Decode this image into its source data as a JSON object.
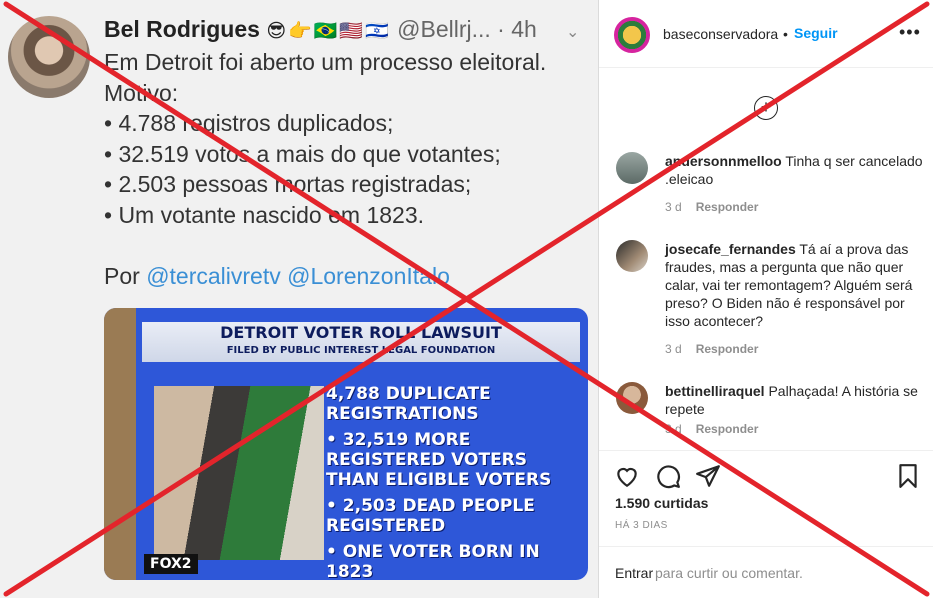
{
  "tweet": {
    "author_name": "Bel Rodrigues",
    "author_emoji": "😎👉🇧🇷🇺🇸🇮🇱",
    "handle": "@Bellrj...",
    "time": "· 4h",
    "lines": [
      "Em Detroit foi aberto um processo eleitoral.",
      "Motivo:",
      "• 4.788 registros duplicados;",
      "• 32.519 votos a mais do que votantes;",
      "• 2.503 pessoas mortas registradas;",
      "• Um votante nascido em 1823."
    ],
    "credit_prefix": "Por",
    "mention_1": "@tercalivretv",
    "mention_2": "@LorenzonItalo"
  },
  "news_image": {
    "title": "DETROIT VOTER ROLL LAWSUIT",
    "subtitle": "FILED BY PUBLIC INTEREST LEGAL FOUNDATION",
    "bullets": [
      "4,788 DUPLICATE REGISTRATIONS",
      "• 32,519 MORE REGISTERED VOTERS THAN ELIGIBLE VOTERS",
      "• 2,503 DEAD PEOPLE REGISTERED",
      "• ONE VOTER BORN IN 1823"
    ],
    "channel": "FOX2"
  },
  "instagram": {
    "username": "baseconservadora",
    "dot": "•",
    "follow_label": "Seguir",
    "comments": [
      {
        "user": "andersonnmelloo",
        "text": "Tinha q ser cancelado .eleicao",
        "age": "3 d",
        "reply": "Responder"
      },
      {
        "user": "josecafe_fernandes",
        "text": "Tá aí a prova das fraudes, mas a pergunta que não quer calar, vai ter remontagem? Alguém será preso? O Biden não é responsável por isso acontecer?",
        "age": "3 d",
        "reply": "Responder"
      },
      {
        "user": "bettinelliraquel",
        "text": "Palhaçada! A história se repete",
        "age": "3 d",
        "reply": "Responder"
      }
    ],
    "likes": "1.590 curtidas",
    "date": "HÁ 3 DIAS",
    "compose_login": "Entrar",
    "compose_rest": "para curtir ou comentar."
  },
  "colors": {
    "link": "#0095f6",
    "mention": "#3a8fd5",
    "cross": "#e3242b"
  }
}
